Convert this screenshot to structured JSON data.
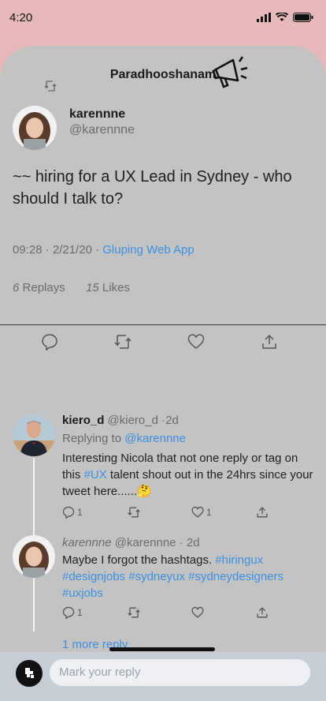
{
  "status": {
    "time": "4:20"
  },
  "header": {
    "title": "Paradhooshanam"
  },
  "tweet": {
    "name": "karennne",
    "handle": "@karennne",
    "text": "~~ hiring for a UX Lead in Sydney - who should I talk to?",
    "time_date": "09:28 · 2/21/20 · ",
    "source": "Gluping Web App",
    "replies_count": "6",
    "replies_label": "Replays",
    "likes_count": "15",
    "likes_label": "Likes"
  },
  "replies": [
    {
      "name": "kiero_d",
      "handle": "@kiero_d",
      "age": "·2d",
      "replying_label": "Replying to ",
      "replying_to": "@karennne",
      "text_before": "Interesting Nicola that not one reply or tag on this ",
      "hashtag": "#UX",
      "text_after": " talent shout out in the 24hrs since your tweet here......",
      "emoji": "🤔",
      "reply_count": "1",
      "like_count": "1"
    },
    {
      "name": "karennne",
      "handle": "@karennne",
      "age": "· 2d",
      "text": "Maybe I forgot the hashtags. ",
      "hashtags_line1": "#hiringux",
      "hashtags_line2": "#designjobs #sydneyux #sydneydesigners",
      "hashtags_line3": "#uxjobs",
      "reply_count": "1"
    }
  ],
  "more_replies": "1 more reply",
  "compose": {
    "placeholder": "Mark your reply"
  },
  "colors": {
    "link": "#3d8fe0",
    "sheet": "#c3c3c3",
    "top_bg": "#e8b9bb"
  }
}
